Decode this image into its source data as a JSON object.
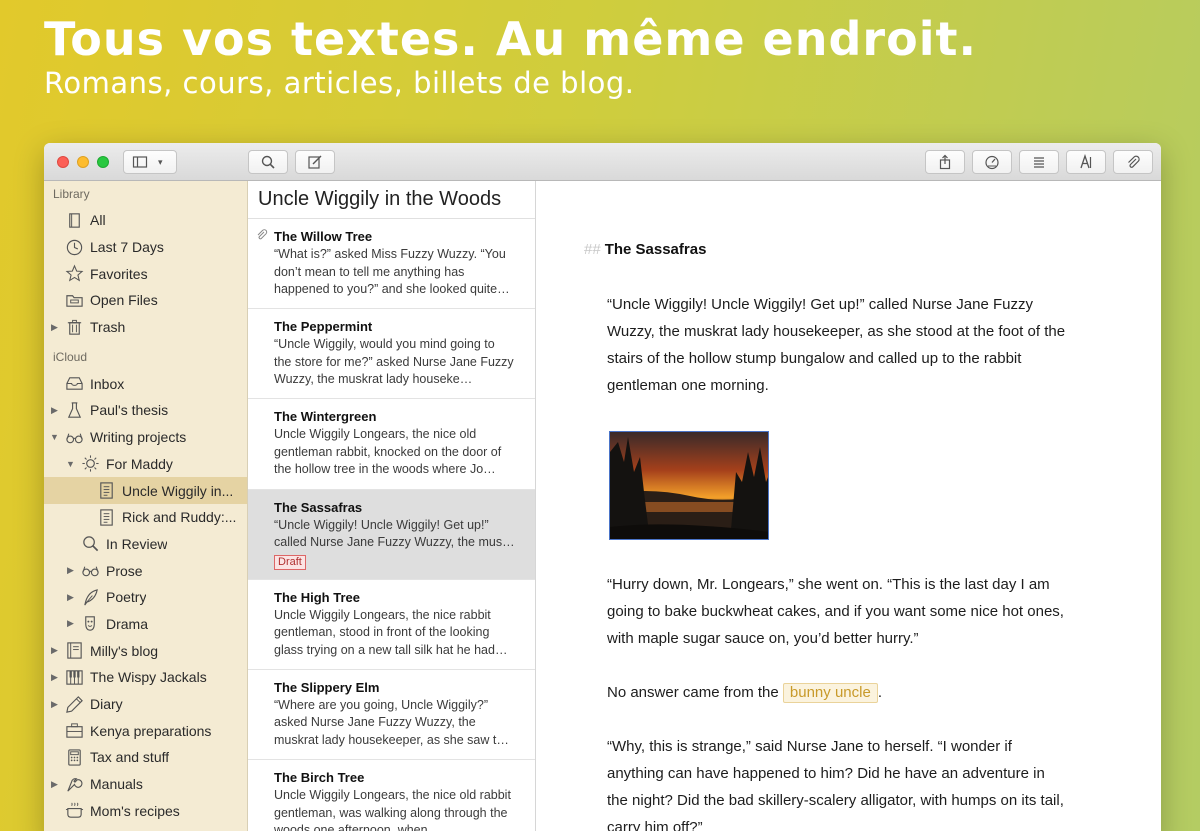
{
  "hero": {
    "title": "Tous vos textes. Au même endroit.",
    "subtitle": "Romans, cours, articles, billets de blog."
  },
  "colors": {
    "sidebar_bg": "#f4ebd3",
    "sidebar_selected": "#e5d3a3",
    "mention_text": "#c89a2a",
    "draft_red": "#b03030",
    "close": "#fc5f57",
    "minimize": "#fdbc2e",
    "zoom": "#28c840"
  },
  "toolbar": {
    "sidebar_toggle_icon": "sidebar-icon",
    "search_icon": "search-icon",
    "compose_icon": "compose-icon",
    "share_icon": "share-icon",
    "goals_icon": "goals-icon",
    "outline_icon": "list-icon",
    "typography_icon": "typography-icon",
    "attachments_icon": "paperclip-icon"
  },
  "sidebar": {
    "library_label": "Library",
    "icloud_label": "iCloud",
    "library": [
      {
        "label": "All",
        "icon": "book-icon"
      },
      {
        "label": "Last 7 Days",
        "icon": "clock-icon"
      },
      {
        "label": "Favorites",
        "icon": "star-icon"
      },
      {
        "label": "Open Files",
        "icon": "folder-icon"
      },
      {
        "label": "Trash",
        "icon": "trash-icon"
      }
    ],
    "icloud": [
      {
        "label": "Inbox",
        "icon": "inbox-icon"
      },
      {
        "label": "Paul's thesis",
        "icon": "flask-icon"
      },
      {
        "label": "Writing projects",
        "icon": "glasses-icon"
      },
      {
        "label": "For Maddy",
        "icon": "sun-icon"
      },
      {
        "label": "Uncle Wiggily in...",
        "icon": "document-icon"
      },
      {
        "label": "Rick and Ruddy:...",
        "icon": "document-icon"
      },
      {
        "label": "In Review",
        "icon": "magnifier-icon"
      },
      {
        "label": "Prose",
        "icon": "glasses-icon"
      },
      {
        "label": "Poetry",
        "icon": "quill-icon"
      },
      {
        "label": "Drama",
        "icon": "mask-icon"
      },
      {
        "label": "Milly's blog",
        "icon": "notebook-icon"
      },
      {
        "label": "The Wispy Jackals",
        "icon": "piano-icon"
      },
      {
        "label": "Diary",
        "icon": "pencil-icon"
      },
      {
        "label": "Kenya preparations",
        "icon": "suitcase-icon"
      },
      {
        "label": "Tax and stuff",
        "icon": "calculator-icon"
      },
      {
        "label": "Manuals",
        "icon": "wrench-icon"
      },
      {
        "label": "Mom's recipes",
        "icon": "cooking-pot-icon"
      }
    ]
  },
  "sheetlist": {
    "group_title": "Uncle Wiggily in the Woods",
    "sheets": [
      {
        "title": "The Willow Tree",
        "body": "“What is?” asked Miss Fuzzy Wuzzy. “You don’t mean to tell me anything has happened to you?” and she looked quite…"
      },
      {
        "title": "The Peppermint",
        "body": "“Uncle Wiggily, would you mind going to the store for me?” asked Nurse Jane Fuzzy Wuzzy, the muskrat lady houseke…"
      },
      {
        "title": "The Wintergreen",
        "body": "Uncle Wiggily Longears, the nice old gentleman rabbit, knocked on the door of the hollow tree in the woods where Jo…"
      },
      {
        "title": "The Sassafras",
        "body": "“Uncle Wiggily! Uncle Wiggily! Get up!” called Nurse Jane Fuzzy Wuzzy, the mus…",
        "badge": "Draft"
      },
      {
        "title": "The High Tree",
        "body": "Uncle Wiggily Longears, the nice rabbit gentleman, stood in front of the looking glass trying on a new tall silk hat he had…"
      },
      {
        "title": "The Slippery Elm",
        "body": "“Where are you going, Uncle Wiggily?” asked Nurse Jane Fuzzy Wuzzy, the muskrat lady housekeeper, as she saw t…"
      },
      {
        "title": "The Birch Tree",
        "body": "Uncle Wiggily Longears, the nice old rabbit gentleman, was walking along through the woods one afternoon, when…"
      }
    ]
  },
  "editor": {
    "heading_marker": "##",
    "heading": "The Sassafras",
    "para1": "“Uncle Wiggily! Uncle Wiggily! Get up!” called Nurse Jane Fuzzy Wuzzy, the muskrat lady housekeeper, as she stood at the foot of the stairs of the hollow stump bungalow and called up to the rabbit gentleman one morning.",
    "para2": "“Hurry down, Mr. Longears,” she went on. “This is the last day I am going to bake buckwheat cakes, and if you want some nice hot ones, with maple sugar sauce on, you’d better hurry.”",
    "para3_prefix": "No answer came from the",
    "para3_mention": "bunny uncle",
    "para3_suffix": ".",
    "para4": "“Why, this is strange,” said Nurse Jane to herself. “I wonder if anything can have happened to him? Did he have an adventure in the night? Did the bad skillery-scalery alligator, with humps on its tail, carry him off?”"
  }
}
